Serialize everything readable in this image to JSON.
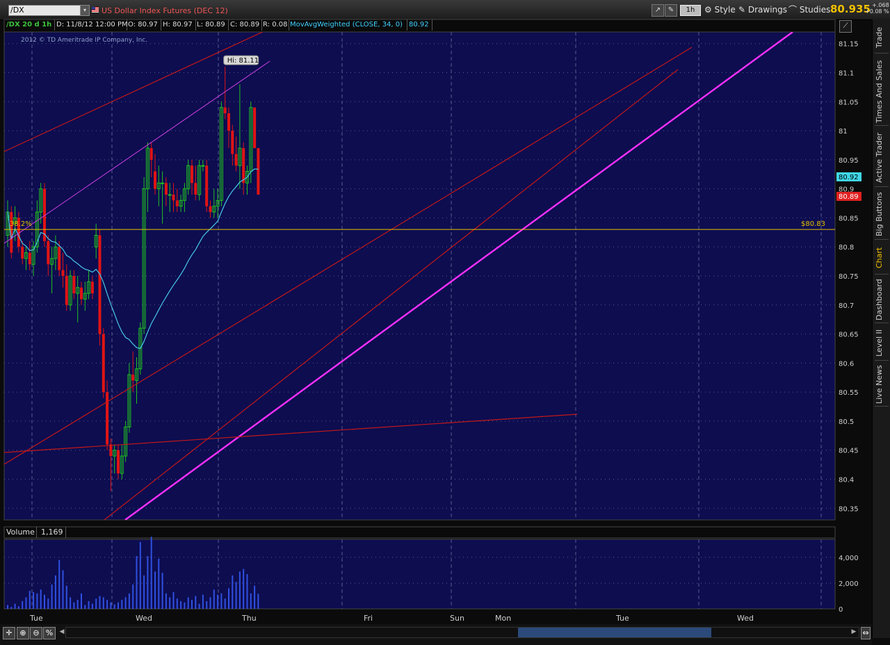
{
  "toolbar": {
    "symbol": "/DX",
    "instrument": "US Dollar Index Futures (DEC 12)",
    "aggregation": "1h",
    "style_label": "Style",
    "drawings_label": "Drawings",
    "studies_label": "Studies",
    "last_price": "80.935",
    "net_change": "+.068",
    "pct_change": "+0.08 %"
  },
  "legend": {
    "symbol_period": "/DX 20 d 1h",
    "date": "D: 11/8/12 12:00 PM",
    "open": "O: 80.97",
    "high": "H: 80.97",
    "low": "L: 80.89",
    "close": "C: 80.89",
    "range": "R: 0.08",
    "study": "MovAvgWeighted (CLOSE, 34, 0)",
    "study_value": "80.92"
  },
  "copyright": "2012 © TD Ameritrade IP Company, Inc.",
  "right_rail_tabs": [
    "Trade",
    "Times And Sales",
    "Active Trader",
    "Big Buttons",
    "Chart",
    "Dashboard",
    "Level II",
    "Live News"
  ],
  "volume_panel": {
    "label": "Volume",
    "value": "1,169"
  },
  "colors": {
    "background": "#0d0d50",
    "grid": "#5a5a8c",
    "up_candle": "#20c020",
    "down_candle": "#e01414",
    "ma_line": "#48c8e8",
    "channel_lines": "#c41818",
    "trendline": "#ff30ff",
    "horizontal_level": "#e8c000",
    "volume_bars": "#3050e0"
  },
  "chart_data": [
    {
      "type": "candlestick",
      "title": "/DX 20 d 1h",
      "x_day_labels": [
        "Tue",
        "Wed",
        "Thu",
        "Fri",
        "Sun",
        "Mon",
        "Tue",
        "Wed"
      ],
      "y_ticks": [
        80.35,
        80.4,
        80.45,
        80.5,
        80.55,
        80.6,
        80.65,
        80.7,
        80.75,
        80.8,
        80.85,
        80.9,
        80.95,
        81,
        81.05,
        81.1,
        81.15
      ],
      "ylim": [
        80.33,
        81.17
      ],
      "grid": true,
      "annotations": [
        {
          "label": "Hi: 81.11",
          "value": 81.11
        },
        {
          "label": "38.2%",
          "value": 80.83
        },
        {
          "label": "$80.83",
          "value": 80.83
        }
      ],
      "price_badges": [
        {
          "label": "80.92",
          "color": "#40d8e8"
        },
        {
          "label": "80.89",
          "color": "#e02020"
        }
      ],
      "horizontal_line": 80.83,
      "candles": [
        [
          80.82,
          80.88,
          80.8,
          80.86
        ],
        [
          80.86,
          80.87,
          80.78,
          80.79
        ],
        [
          80.84,
          80.87,
          80.81,
          80.85
        ],
        [
          80.85,
          80.86,
          80.79,
          80.8
        ],
        [
          80.8,
          80.81,
          80.77,
          80.78
        ],
        [
          80.78,
          80.8,
          80.76,
          80.79
        ],
        [
          80.79,
          80.81,
          80.76,
          80.77
        ],
        [
          80.77,
          80.81,
          80.75,
          80.8
        ],
        [
          80.8,
          80.88,
          80.79,
          80.86
        ],
        [
          80.86,
          80.91,
          80.84,
          80.9
        ],
        [
          80.9,
          80.91,
          80.8,
          80.81
        ],
        [
          80.81,
          80.82,
          80.75,
          80.77
        ],
        [
          80.77,
          80.8,
          80.72,
          80.78
        ],
        [
          80.78,
          80.82,
          80.76,
          80.8
        ],
        [
          80.8,
          80.81,
          80.75,
          80.76
        ],
        [
          80.76,
          80.79,
          80.73,
          80.75
        ],
        [
          80.75,
          80.77,
          80.69,
          80.7
        ],
        [
          80.7,
          80.76,
          80.69,
          80.75
        ],
        [
          80.75,
          80.76,
          80.71,
          80.72
        ],
        [
          80.72,
          80.75,
          80.67,
          80.73
        ],
        [
          80.73,
          80.74,
          80.7,
          80.71
        ],
        [
          80.71,
          80.74,
          80.69,
          80.72
        ],
        [
          80.72,
          80.76,
          80.71,
          80.74
        ],
        [
          80.74,
          80.75,
          80.71,
          80.72
        ],
        [
          80.8,
          80.84,
          80.78,
          80.82
        ],
        [
          80.82,
          80.83,
          80.63,
          80.65
        ],
        [
          80.65,
          80.66,
          80.54,
          80.55
        ],
        [
          80.55,
          80.57,
          80.45,
          80.46
        ],
        [
          80.46,
          80.47,
          80.38,
          80.44
        ],
        [
          80.44,
          80.46,
          80.41,
          80.45
        ],
        [
          80.45,
          80.46,
          80.4,
          80.41
        ],
        [
          80.41,
          80.46,
          80.4,
          80.44
        ],
        [
          80.44,
          80.5,
          80.43,
          80.49
        ],
        [
          80.49,
          80.6,
          80.48,
          80.58
        ],
        [
          80.58,
          80.62,
          80.55,
          80.57
        ],
        [
          80.57,
          80.61,
          80.53,
          80.59
        ],
        [
          80.59,
          80.67,
          80.58,
          80.66
        ],
        [
          80.66,
          80.92,
          80.65,
          80.9
        ],
        [
          80.9,
          80.98,
          80.86,
          80.97
        ],
        [
          80.97,
          80.98,
          80.92,
          80.95
        ],
        [
          80.93,
          80.96,
          80.89,
          80.9
        ],
        [
          80.9,
          80.94,
          80.87,
          80.91
        ],
        [
          80.91,
          80.93,
          80.84,
          80.91
        ],
        [
          80.91,
          80.92,
          80.87,
          80.89
        ],
        [
          80.89,
          80.91,
          80.86,
          80.89
        ],
        [
          80.89,
          80.91,
          80.86,
          80.88
        ],
        [
          80.88,
          80.9,
          80.86,
          80.87
        ],
        [
          80.87,
          80.89,
          80.86,
          80.88
        ],
        [
          80.88,
          80.91,
          80.86,
          80.9
        ],
        [
          80.9,
          80.95,
          80.89,
          80.94
        ],
        [
          80.94,
          80.95,
          80.89,
          80.91
        ],
        [
          80.91,
          80.94,
          80.88,
          80.89
        ],
        [
          80.89,
          80.95,
          80.88,
          80.94
        ],
        [
          80.94,
          80.95,
          80.93,
          80.94
        ],
        [
          80.94,
          80.95,
          80.86,
          80.87
        ],
        [
          80.87,
          80.88,
          80.85,
          80.86
        ],
        [
          80.86,
          80.9,
          80.85,
          80.87
        ],
        [
          80.87,
          80.9,
          80.85,
          80.88
        ],
        [
          80.88,
          81.05,
          80.87,
          81.04
        ],
        [
          81.04,
          81.11,
          81.02,
          81.03
        ],
        [
          81.03,
          81.04,
          80.97,
          81.0
        ],
        [
          81.0,
          81.01,
          80.94,
          80.96
        ],
        [
          80.96,
          80.99,
          80.93,
          80.94
        ],
        [
          80.94,
          81.08,
          80.9,
          80.97
        ],
        [
          80.97,
          80.98,
          80.89,
          80.91
        ],
        [
          80.91,
          80.94,
          80.89,
          80.93
        ],
        [
          80.93,
          81.05,
          80.91,
          81.04
        ],
        [
          81.04,
          81.04,
          80.97,
          80.97
        ],
        [
          80.97,
          80.97,
          80.89,
          80.89
        ]
      ]
    },
    {
      "type": "bar",
      "title": "Volume",
      "y_ticks": [
        0,
        2000,
        4000
      ],
      "ylim": [
        0,
        5400
      ],
      "values": [
        300,
        150,
        400,
        200,
        600,
        900,
        1400,
        1300,
        1200,
        1500,
        1100,
        800,
        1900,
        2600,
        3800,
        3000,
        1800,
        900,
        500,
        700,
        1200,
        300,
        600,
        400,
        800,
        1000,
        900,
        700,
        500,
        350,
        500,
        700,
        900,
        1200,
        1900,
        4100,
        5200,
        2600,
        4100,
        5600,
        2900,
        3900,
        2800,
        1200,
        900,
        1300,
        800,
        600,
        500,
        900,
        700,
        1000,
        400,
        1100,
        600,
        900,
        1500,
        1100,
        1200,
        800,
        1600,
        2600,
        2100,
        2900,
        3100,
        2700,
        1200,
        1800,
        1169
      ]
    }
  ]
}
